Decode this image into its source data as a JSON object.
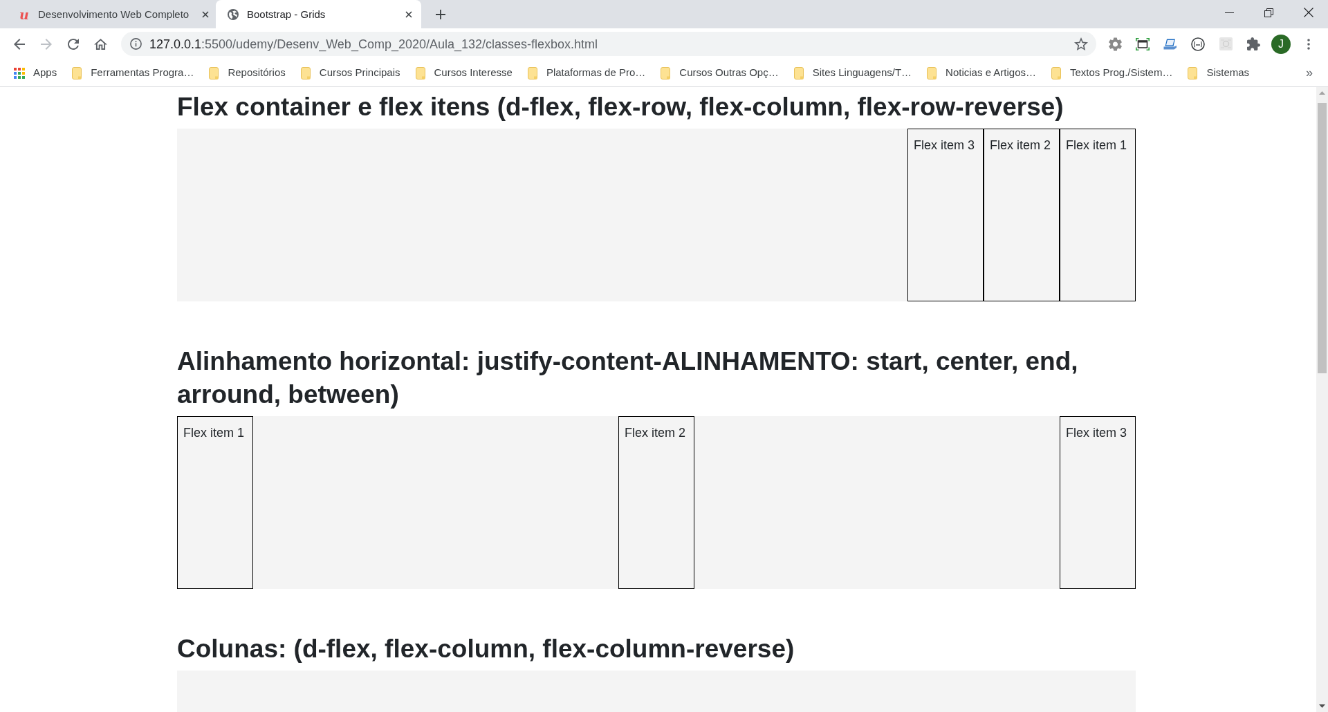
{
  "browser": {
    "tabs": [
      {
        "favicon": "u",
        "title": "Desenvolvimento Web Completo",
        "selected": false
      },
      {
        "title": "Bootstrap - Grids",
        "selected": true
      }
    ],
    "navigation": [
      {
        "kind": "back",
        "disabled": false
      },
      {
        "kind": "forward",
        "disabled": true
      },
      {
        "kind": "reload",
        "disabled": false
      },
      {
        "kind": "home",
        "disabled": false
      }
    ],
    "address_bar": {
      "host": "127.0.0.1",
      "path": ":5500/udemy/Desenv_Web_Comp_2020/Aula_132/classes-flexbox.html"
    },
    "profile_initial": "J",
    "bookmarks": [
      {
        "kind": "apps",
        "label": "Apps"
      },
      {
        "kind": "folder",
        "label": "Ferramentas Progra…"
      },
      {
        "kind": "folder",
        "label": "Repositórios"
      },
      {
        "kind": "folder",
        "label": "Cursos Principais"
      },
      {
        "kind": "folder",
        "label": "Cursos Interesse"
      },
      {
        "kind": "folder",
        "label": "Plataformas de Pro…"
      },
      {
        "kind": "folder",
        "label": "Cursos Outras Opç…"
      },
      {
        "kind": "folder",
        "label": "Sites Linguagens/T…"
      },
      {
        "kind": "folder",
        "label": "Noticias e Artigos…"
      },
      {
        "kind": "folder",
        "label": "Textos Prog./Sistem…"
      },
      {
        "kind": "folder",
        "label": "Sistemas"
      }
    ],
    "bookmarks_overflow": "»"
  },
  "page": {
    "sections": [
      {
        "heading": "Flex container e flex itens (d-flex, flex-row, flex-column, flex-row-reverse)",
        "kind": "right",
        "items": [
          "Flex item 3",
          "Flex item 2",
          "Flex item 1"
        ]
      },
      {
        "heading": "Alinhamento horizontal: justify-content-ALINHAMENTO: start, center, end, arround, between)",
        "kind": "spread",
        "items": [
          "Flex item 1",
          "Flex item 2",
          "Flex item 3"
        ]
      },
      {
        "heading": "Colunas: (d-flex, flex-column, flex-column-reverse)"
      }
    ]
  }
}
